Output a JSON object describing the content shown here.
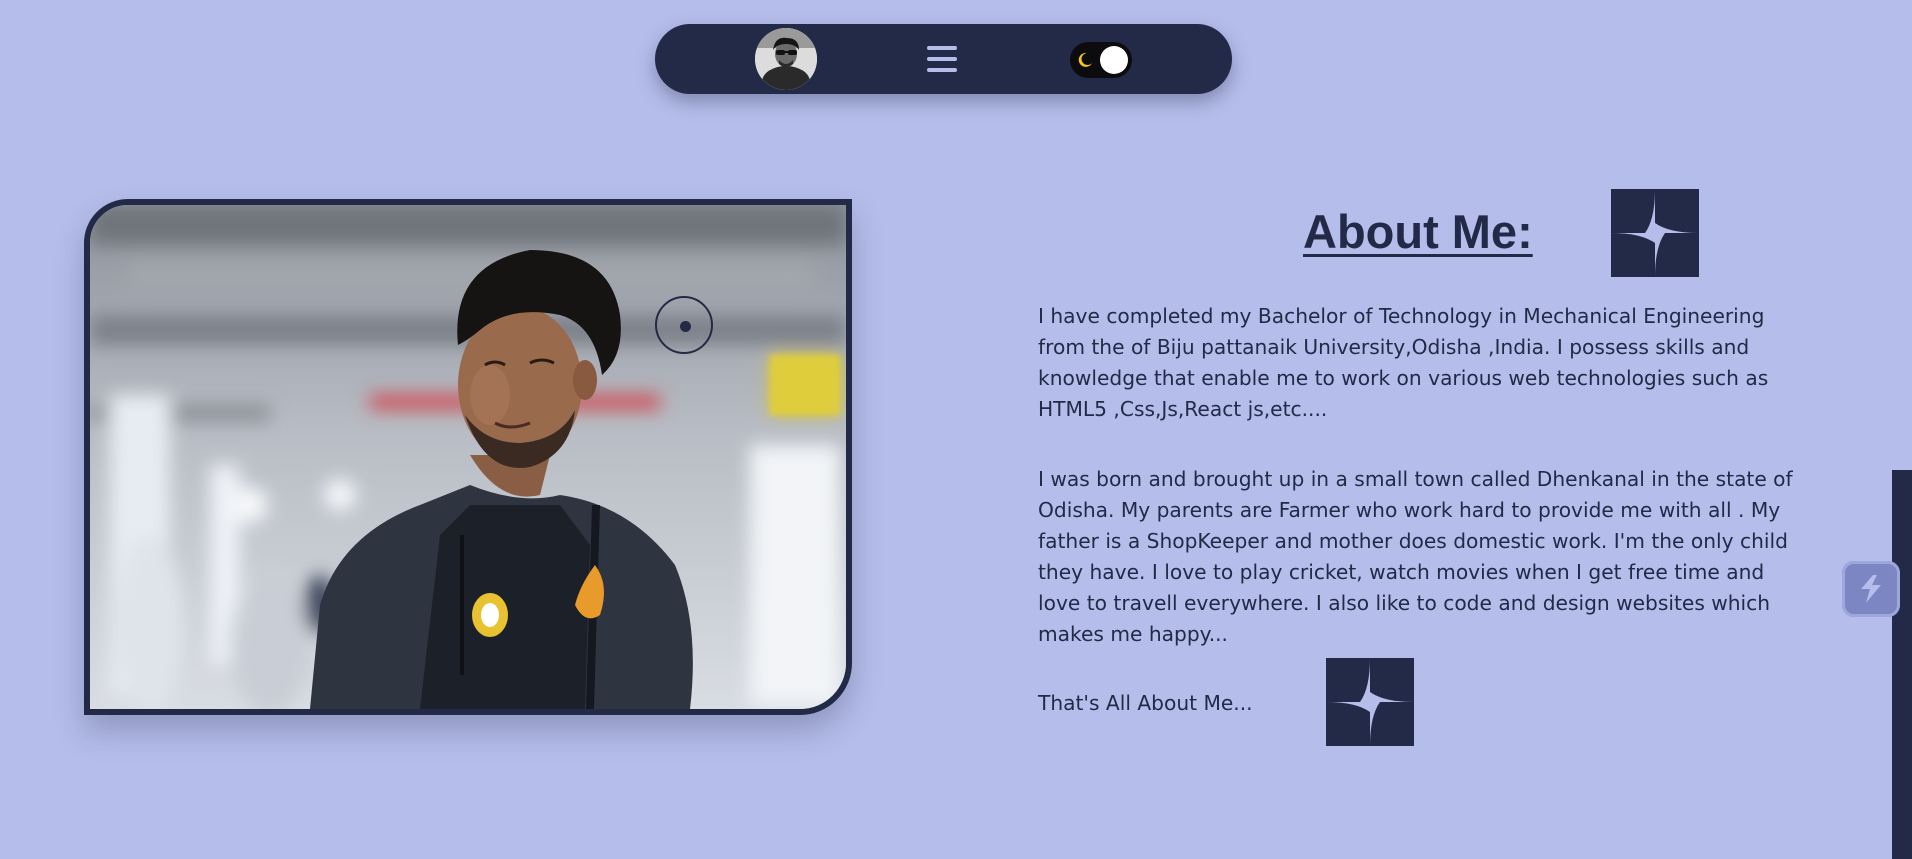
{
  "nav": {
    "avatar_icon": "profile-avatar",
    "menu_icon": "hamburger-menu-icon",
    "theme_toggle_icon": "moon-icon",
    "theme_mode": "dark"
  },
  "photo": {
    "description_icon": "profile-photo"
  },
  "about": {
    "title": "About Me:",
    "paragraph_1": "I have completed my Bachelor of Technology in Mechanical Engineering from the of Biju pattanaik University,Odisha ,India. I possess skills and knowledge that enable me to work on various web technologies such as HTML5 ,Css,Js,React js,etc....",
    "paragraph_2": "I was born and brought up in a small town called Dhenkanal in the state of Odisha. My parents are Farmer who work hard to provide me with all . My father is a ShopKeeper and mother does domestic work. I'm the only child they have. I love to play cricket, watch movies when I get free time and love to travell everywhere. I also like to code and design websites which makes me happy...",
    "closing": "That's All About Me..."
  },
  "colors": {
    "background": "#b5bdea",
    "primary_dark": "#232a48",
    "toggle_moon": "#f5c518"
  },
  "icons": {
    "decor": "pinwheel-icon",
    "side_widget": "lightning-icon"
  }
}
